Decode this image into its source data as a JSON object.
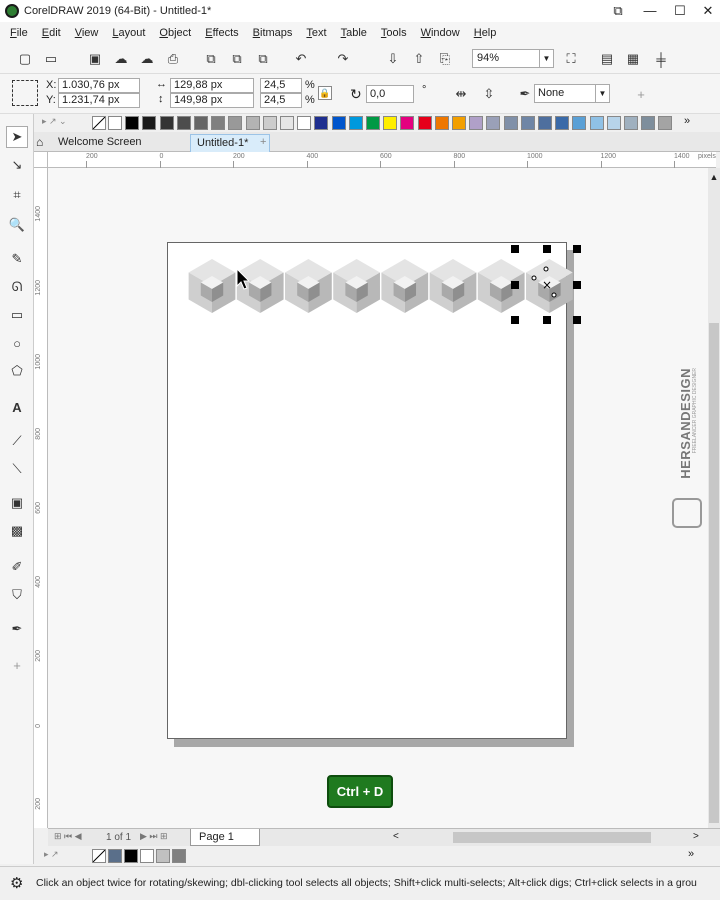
{
  "window": {
    "title": "CorelDRAW 2019 (64-Bit) - Untitled-1*",
    "min": "—",
    "max": "☐",
    "close": "✕"
  },
  "menu": [
    "File",
    "Edit",
    "View",
    "Layout",
    "Object",
    "Effects",
    "Bitmaps",
    "Text",
    "Table",
    "Tools",
    "Window",
    "Help"
  ],
  "toolbar": {
    "zoom_value": "94%"
  },
  "propbar": {
    "x_label": "X:",
    "x_value": "1.030,76 px",
    "y_label": "Y:",
    "y_value": "1.231,74 px",
    "w_value": "129,88 px",
    "h_value": "149,98 px",
    "scale_w": "24,5",
    "scale_h": "24,5",
    "pct1": "%",
    "pct2": "%",
    "rotation": "0,0",
    "degree": "°",
    "outline": "None"
  },
  "tabs": {
    "welcome": "Welcome Screen",
    "doc": "Untitled-1*",
    "add": "+"
  },
  "ruler": {
    "h_ticks": [
      "200",
      "0",
      "200",
      "400",
      "600",
      "800",
      "1000",
      "1200",
      "1400"
    ],
    "h_unit": "pixels",
    "v_ticks": [
      "1400",
      "1200",
      "1000",
      "800",
      "600",
      "400",
      "200",
      "0",
      "200"
    ]
  },
  "pagenav": {
    "counter": "1 of 1",
    "page_tab": "Page 1"
  },
  "status": {
    "hint": "Click an object twice for rotating/skewing; dbl-clicking tool selects all objects; Shift+click multi-selects; Alt+click digs; Ctrl+click selects in a grou"
  },
  "shortcut_badge": "Ctrl + D",
  "watermark": {
    "brand": "HERSANDESIGN",
    "tagline": "FREELANCER GRAPHIC DESIGNER"
  },
  "palette_colors": [
    "#ffffff",
    "#000000",
    "#1a1a1a",
    "#333333",
    "#4d4d4d",
    "#666666",
    "#808080",
    "#999999",
    "#b3b3b3",
    "#cccccc",
    "#e6e6e6",
    "#ffffff",
    "#1f2f8f",
    "#0055cc",
    "#0099dd",
    "#009944",
    "#ffee00",
    "#e4007f",
    "#e6001a",
    "#ee7700",
    "#f29f00",
    "#b0a0c8",
    "#9aa0b8",
    "#8090a8",
    "#6f86a6",
    "#4e6f9e",
    "#3a6aa8",
    "#5aa0d6",
    "#8fc1e6",
    "#b7d4ea",
    "#9fb0bf",
    "#7e8e9c",
    "#a4a4a4"
  ],
  "doc_palette": [
    "#5a6f8a",
    "#000000",
    "#ffffff",
    "#c0c0c0",
    "#808080"
  ],
  "hex_count": 8
}
